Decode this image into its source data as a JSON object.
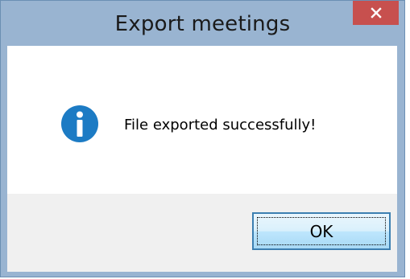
{
  "dialog": {
    "title": "Export meetings",
    "message": "File exported successfully!",
    "ok_label": "OK",
    "close_glyph": "×",
    "icon": "info-icon"
  },
  "colors": {
    "frame": "#99b4d1",
    "close_button": "#c7504e",
    "info_icon": "#1c7bc4",
    "button_footer": "#f0f0f0"
  }
}
